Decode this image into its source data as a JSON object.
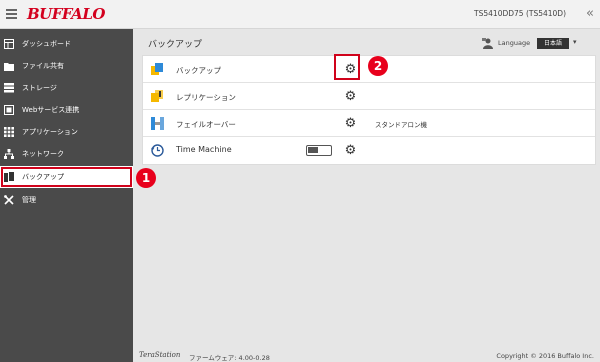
{
  "header": {
    "logo": "BUFFALO",
    "model": "TS5410DD75 (TS5410D)",
    "collapse_glyph": "«"
  },
  "sidebar": {
    "items": [
      {
        "label": "ダッシュボード",
        "icon": "dashboard-icon"
      },
      {
        "label": "ファイル共有",
        "icon": "folder-icon"
      },
      {
        "label": "ストレージ",
        "icon": "storage-icon"
      },
      {
        "label": "Webサービス連携",
        "icon": "web-service-icon"
      },
      {
        "label": "アプリケーション",
        "icon": "grid-icon"
      },
      {
        "label": "ネットワーク",
        "icon": "network-icon"
      },
      {
        "label": "バックアップ",
        "icon": "backup-icon",
        "active": true
      },
      {
        "label": "管理",
        "icon": "tools-icon"
      }
    ]
  },
  "main": {
    "title": "バックアップ",
    "language_label": "Language",
    "language_value": "日本語",
    "rows": [
      {
        "label": "バックアップ",
        "icon": "backup-app-icon"
      },
      {
        "label": "レプリケーション",
        "icon": "replication-app-icon"
      },
      {
        "label": "フェイルオーバー",
        "icon": "failover-app-icon",
        "mode": "スタンドアロン機"
      },
      {
        "label": "Time Machine",
        "icon": "time-machine-icon",
        "toggle": "off"
      }
    ]
  },
  "annotations": {
    "badge_1": "1",
    "badge_2": "2"
  },
  "footer": {
    "brand": "TeraStation",
    "firmware": "ファームウェア: 4.00-0.28",
    "copyright": "Copyright © 2016 Buffalo Inc."
  },
  "colors": {
    "brand_red": "#d3001e",
    "highlight_red": "#d0021b",
    "sidebar_bg": "#4a4a4a",
    "main_bg": "#e6e6e6"
  }
}
